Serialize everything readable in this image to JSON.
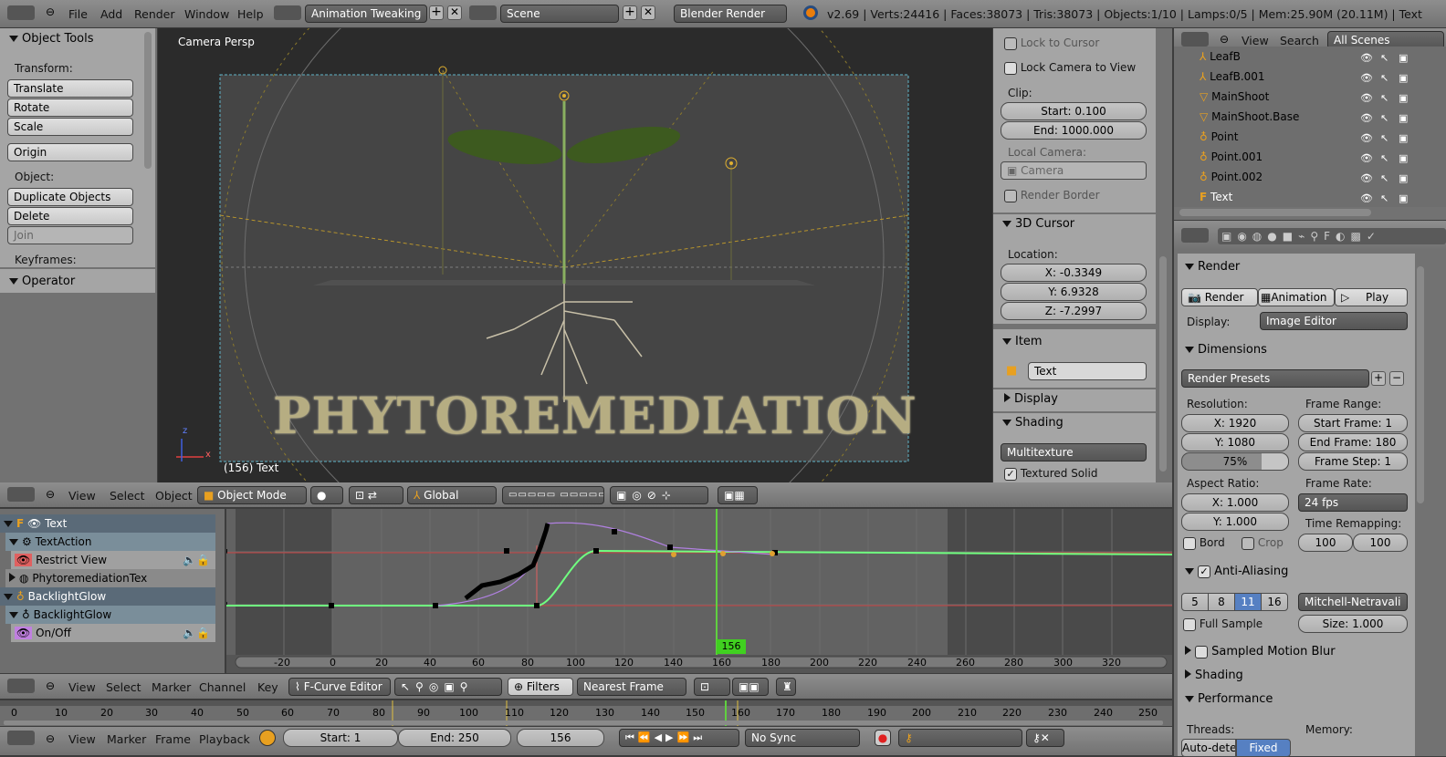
{
  "topbar": {
    "menus": [
      "File",
      "Add",
      "Render",
      "Window",
      "Help"
    ],
    "screen": "Animation Tweaking",
    "scene": "Scene",
    "engine": "Blender Render",
    "stats": "v2.69 | Verts:24416 | Faces:38073 | Tris:38073 | Objects:1/10 | Lamps:0/5 | Mem:25.90M (20.11M) | Text"
  },
  "tools": {
    "title": "Object Tools",
    "transform": "Transform:",
    "translate": "Translate",
    "rotate": "Rotate",
    "scale": "Scale",
    "origin": "Origin",
    "object": "Object:",
    "duplicate": "Duplicate Objects",
    "delete": "Delete",
    "join": "Join",
    "keyframes": "Keyframes:",
    "operator": "Operator"
  },
  "viewport": {
    "label": "Camera Persp",
    "status": "(156) Text",
    "text3d": "PHYTOREMEDIATION",
    "axis_z": "z",
    "axis_x": "x"
  },
  "props": {
    "lock_cursor": "Lock to Cursor",
    "lock_camera": "Lock Camera to View",
    "clip": "Clip:",
    "clip_start": "Start: 0.100",
    "clip_end": "End: 1000.000",
    "local_camera": "Local Camera:",
    "camera": "Camera",
    "render_border": "Render Border",
    "cursor_title": "3D Cursor",
    "location": "Location:",
    "cx": "X: -0.3349",
    "cy": "Y: 6.9328",
    "cz": "Z: -7.2997",
    "item_title": "Item",
    "item_name": "Text",
    "display_title": "Display",
    "shading_title": "Shading",
    "shading_mode": "Multitexture",
    "textured_solid": "Textured Solid"
  },
  "outliner": {
    "view": "View",
    "search": "Search",
    "filter": "All Scenes",
    "items": [
      "LeafB",
      "LeafB.001",
      "MainShoot",
      "MainShoot.Base",
      "Point",
      "Point.001",
      "Point.002",
      "Text"
    ]
  },
  "render": {
    "render_title": "Render",
    "render_btn": "Render",
    "animation_btn": "Animation",
    "play_btn": "Play",
    "display_lbl": "Display:",
    "display_val": "Image Editor",
    "dims_title": "Dimensions",
    "presets": "Render Presets",
    "resolution": "Resolution:",
    "res_x": "X: 1920",
    "res_y": "Y: 1080",
    "res_pct": "75%",
    "frame_range": "Frame Range:",
    "start_frame": "Start Frame: 1",
    "end_frame": "End Frame: 180",
    "frame_step": "Frame Step: 1",
    "aspect": "Aspect Ratio:",
    "asp_x": "X: 1.000",
    "asp_y": "Y: 1.000",
    "frame_rate": "Frame Rate:",
    "fps": "24 fps",
    "time_remap": "Time Remapping:",
    "remap_a": "100",
    "remap_b": "100",
    "bord": "Bord",
    "crop": "Crop",
    "aa_title": "Anti-Aliasing",
    "aa_levels": [
      "5",
      "8",
      "11",
      "16"
    ],
    "aa_filter": "Mitchell-Netravali",
    "full_sample": "Full Sample",
    "size": "Size: 1.000",
    "smb_title": "Sampled Motion Blur",
    "shading_title": "Shading",
    "perf_title": "Performance",
    "threads": "Threads:",
    "memory": "Memory:",
    "auto_detect": "Auto-dete",
    "fixed": "Fixed"
  },
  "view3d_header": {
    "view": "View",
    "select": "Select",
    "object": "Object",
    "mode": "Object Mode",
    "orientation": "Global"
  },
  "graph": {
    "channels": [
      "Text",
      "TextAction",
      "Restrict View",
      "PhytoremediationTex",
      "BacklightGlow",
      "BacklightGlow",
      "On/Off"
    ],
    "ticks": [
      "-20",
      "0",
      "20",
      "40",
      "60",
      "80",
      "100",
      "120",
      "140",
      "160",
      "180",
      "200",
      "220",
      "240",
      "260",
      "280",
      "300",
      "320"
    ],
    "current_frame": "156",
    "y_one": "1",
    "y_zero": "0"
  },
  "graph_header": {
    "view": "View",
    "select": "Select",
    "marker": "Marker",
    "channel": "Channel",
    "key": "Key",
    "editor": "F-Curve Editor",
    "filters": "Filters",
    "snap": "Nearest Frame"
  },
  "timeline": {
    "ticks": [
      "0",
      "10",
      "20",
      "30",
      "40",
      "50",
      "60",
      "70",
      "80",
      "90",
      "100",
      "110",
      "120",
      "130",
      "140",
      "150",
      "160",
      "170",
      "180",
      "190",
      "200",
      "210",
      "220",
      "230",
      "240",
      "250"
    ],
    "view": "View",
    "marker": "Marker",
    "frame": "Frame",
    "playback": "Playback",
    "start": "Start: 1",
    "end": "End: 250",
    "current": "156",
    "sync": "No Sync"
  }
}
